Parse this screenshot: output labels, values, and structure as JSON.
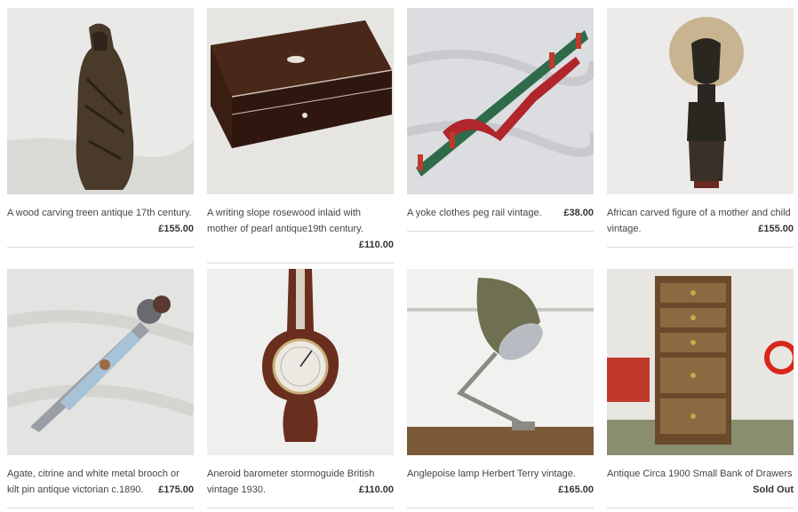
{
  "products": [
    {
      "title": "A wood carving treen antique 17th century.",
      "price": "£155.00"
    },
    {
      "title": "A writing slope rosewood inlaid with mother of pearl antique19th century.",
      "price": "£110.00"
    },
    {
      "title": "A yoke clothes peg rail vintage.",
      "price": "£38.00"
    },
    {
      "title": "African carved figure of a mother and child vintage.",
      "price": "£155.00"
    },
    {
      "title": "Agate, citrine and white metal brooch or kilt pin antique victorian c.1890.",
      "price": "£175.00"
    },
    {
      "title": "Aneroid barometer stormoguide British vintage 1930.",
      "price": "£110.00"
    },
    {
      "title": "Anglepoise lamp Herbert Terry vintage.",
      "price": "£165.00"
    },
    {
      "title": "Antique Circa 1900 Small Bank of Drawers",
      "price": "Sold Out"
    }
  ]
}
